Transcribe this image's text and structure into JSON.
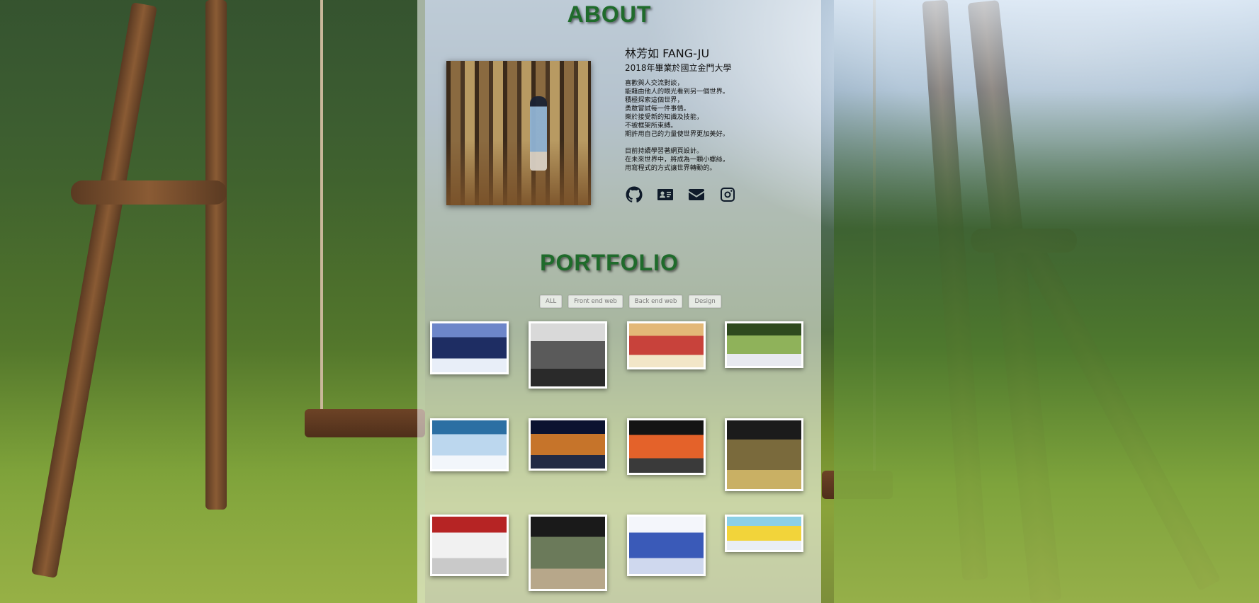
{
  "about": {
    "title": "ABOUT",
    "name": "林芳如 FANG-JU",
    "school": "2018年畢業於國立金門大學",
    "bio_lines": [
      "喜歡與人交流對談，",
      "能藉由他人的眼光看到另一個世界。",
      "積極探索這個世界，",
      "勇敢嘗試每一件事情。",
      "樂於接受新的知識及技能，",
      "不被框架所束縛。",
      "期許用自己的力量使世界更加美好。",
      "",
      "目前持續學習著網頁設計。",
      "在未來世界中，將成為一顆小螺絲，",
      "用寫程式的方式讓世界轉動的。"
    ],
    "socials": [
      {
        "icon": "github-icon"
      },
      {
        "icon": "id-card-icon"
      },
      {
        "icon": "envelope-icon"
      },
      {
        "icon": "instagram-icon"
      }
    ]
  },
  "portfolio": {
    "title": "PORTFOLIO",
    "filters": [
      "ALL",
      "Front end web",
      "Back end web",
      "Design"
    ],
    "thumbnails": [
      {
        "colors": [
          "#6d86c9",
          "#1e2d63",
          "#e8eef8"
        ]
      },
      {
        "colors": [
          "#d9d9d9",
          "#5a5a5a",
          "#2a2a2a"
        ]
      },
      {
        "colors": [
          "#e3b878",
          "#c8423b",
          "#f2e6c8"
        ]
      },
      {
        "colors": [
          "#2e4a1e",
          "#8fb25a",
          "#e8eaf0"
        ]
      },
      {
        "colors": [
          "#2b6fa3",
          "#bcd7ee",
          "#f2f6fb"
        ]
      },
      {
        "colors": [
          "#0b1230",
          "#c6742a",
          "#222a44"
        ]
      },
      {
        "colors": [
          "#141414",
          "#e4622a",
          "#3a3a3a"
        ]
      },
      {
        "colors": [
          "#1b1b1b",
          "#7a6a3c",
          "#c9b064"
        ]
      },
      {
        "colors": [
          "#b62424",
          "#f1f1f1",
          "#c9c9c9"
        ]
      },
      {
        "colors": [
          "#1a1a1a",
          "#6b7a5a",
          "#b7a78a"
        ]
      },
      {
        "colors": [
          "#f4f6fb",
          "#3a5ab8",
          "#cfd8ee"
        ]
      },
      {
        "colors": [
          "#8bcfe6",
          "#f2d43a",
          "#e9eef5"
        ]
      }
    ]
  },
  "colors": {
    "accent": "#1f6b2b",
    "panel": "rgba(255,255,255,0.55)"
  }
}
